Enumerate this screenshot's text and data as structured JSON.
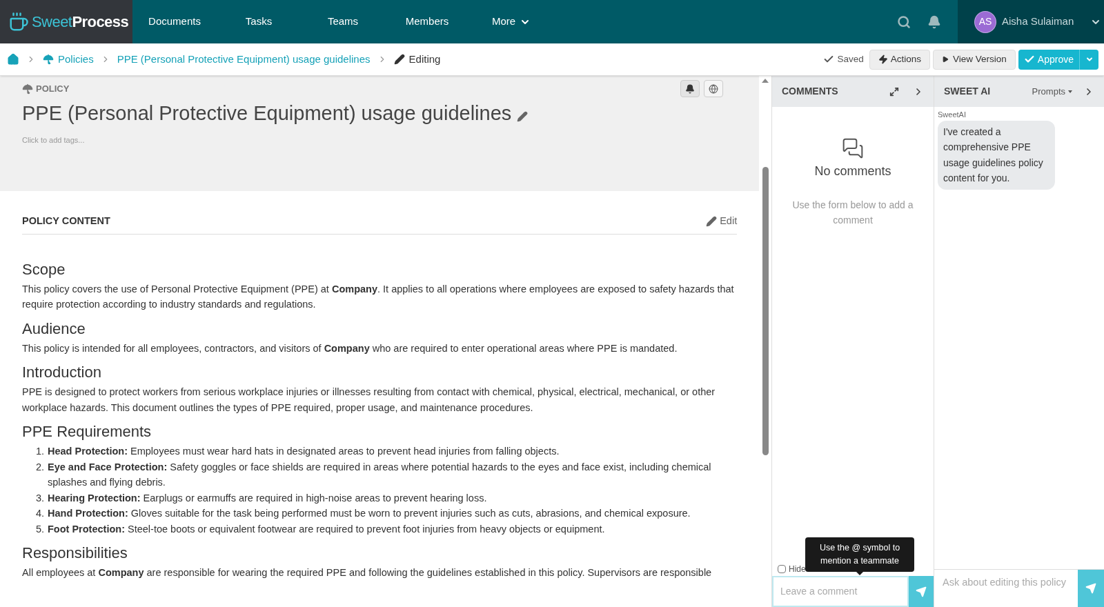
{
  "brand": {
    "light": "Sweet",
    "bold": "Process"
  },
  "nav": [
    {
      "label": "Documents",
      "dropdown": false
    },
    {
      "label": "Tasks",
      "dropdown": false
    },
    {
      "label": "Teams",
      "dropdown": false
    },
    {
      "label": "Members",
      "dropdown": false
    },
    {
      "label": "More",
      "dropdown": true
    }
  ],
  "user": {
    "initials": "AS",
    "name": "Aisha Sulaiman"
  },
  "breadcrumb": [
    {
      "label": "Policies",
      "kind": "policy"
    },
    {
      "label": "PPE (Personal Protective Equipment) usage guidelines",
      "kind": "link"
    },
    {
      "label": "Editing",
      "kind": "current"
    }
  ],
  "toolbar": {
    "status": "Saved",
    "actions": "Actions",
    "view_version": "View Version",
    "approve": "Approve"
  },
  "document": {
    "type": "POLICY",
    "title": "PPE (Personal Protective Equipment) usage guidelines",
    "tags_placeholder": "Click to add tags..."
  },
  "content": {
    "heading": "POLICY CONTENT",
    "edit": "Edit",
    "sections": [
      {
        "title": "Scope",
        "paragraphs": [
          "This policy covers the use of Personal Protective Equipment (PPE) at **Company**. It applies to all operations where employees are exposed to safety hazards that require protection according to industry standards and regulations."
        ]
      },
      {
        "title": "Audience",
        "paragraphs": [
          "This policy is intended for all employees, contractors, and visitors of **Company** who are required to enter operational areas where PPE is mandated."
        ]
      },
      {
        "title": "Introduction",
        "paragraphs": [
          "PPE is designed to protect workers from serious workplace injuries or illnesses resulting from contact with chemical, physical, electrical, mechanical, or other workplace hazards. This document outlines the types of PPE required, proper usage, and maintenance procedures."
        ]
      },
      {
        "title": "PPE Requirements",
        "items": [
          {
            "number": "1.",
            "text": "**Head Protection:** Employees must wear hard hats in designated areas to prevent head injuries from falling objects."
          },
          {
            "number": "2.",
            "text": "**Eye and Face Protection:** Safety goggles or face shields are required in areas where potential hazards to the eyes and face exist, including chemical splashes and flying debris."
          },
          {
            "number": "3.",
            "text": "**Hearing Protection:** Earplugs or earmuffs are required in high-noise areas to prevent hearing loss."
          },
          {
            "number": "4.",
            "text": "**Hand Protection:** Gloves suitable for the task being performed must be worn to prevent injuries such as cuts, abrasions, and chemical exposure."
          },
          {
            "number": "5.",
            "text": "**Foot Protection:** Steel-toe boots or equivalent footwear are required to prevent foot injuries from heavy objects or equipment."
          }
        ]
      },
      {
        "title": "Responsibilities",
        "paragraphs": [
          "All employees at **Company** are responsible for wearing the required PPE and following the guidelines established in this policy. Supervisors are responsible"
        ]
      }
    ]
  },
  "comments": {
    "title": "COMMENTS",
    "empty_title": "No comments",
    "empty_hint": "Use the form below to add a comment",
    "hide_label": "Hide",
    "hide_checked": false,
    "tooltip": "Use the @ symbol to mention a teammate",
    "placeholder": "Leave a comment"
  },
  "ai": {
    "title": "SWEET AI",
    "prompts": "Prompts",
    "messages": [
      {
        "sender": "SweetAI",
        "text": "I've created a comprehensive PPE usage guidelines policy content for you."
      }
    ],
    "placeholder": "Ask about editing this policy"
  }
}
